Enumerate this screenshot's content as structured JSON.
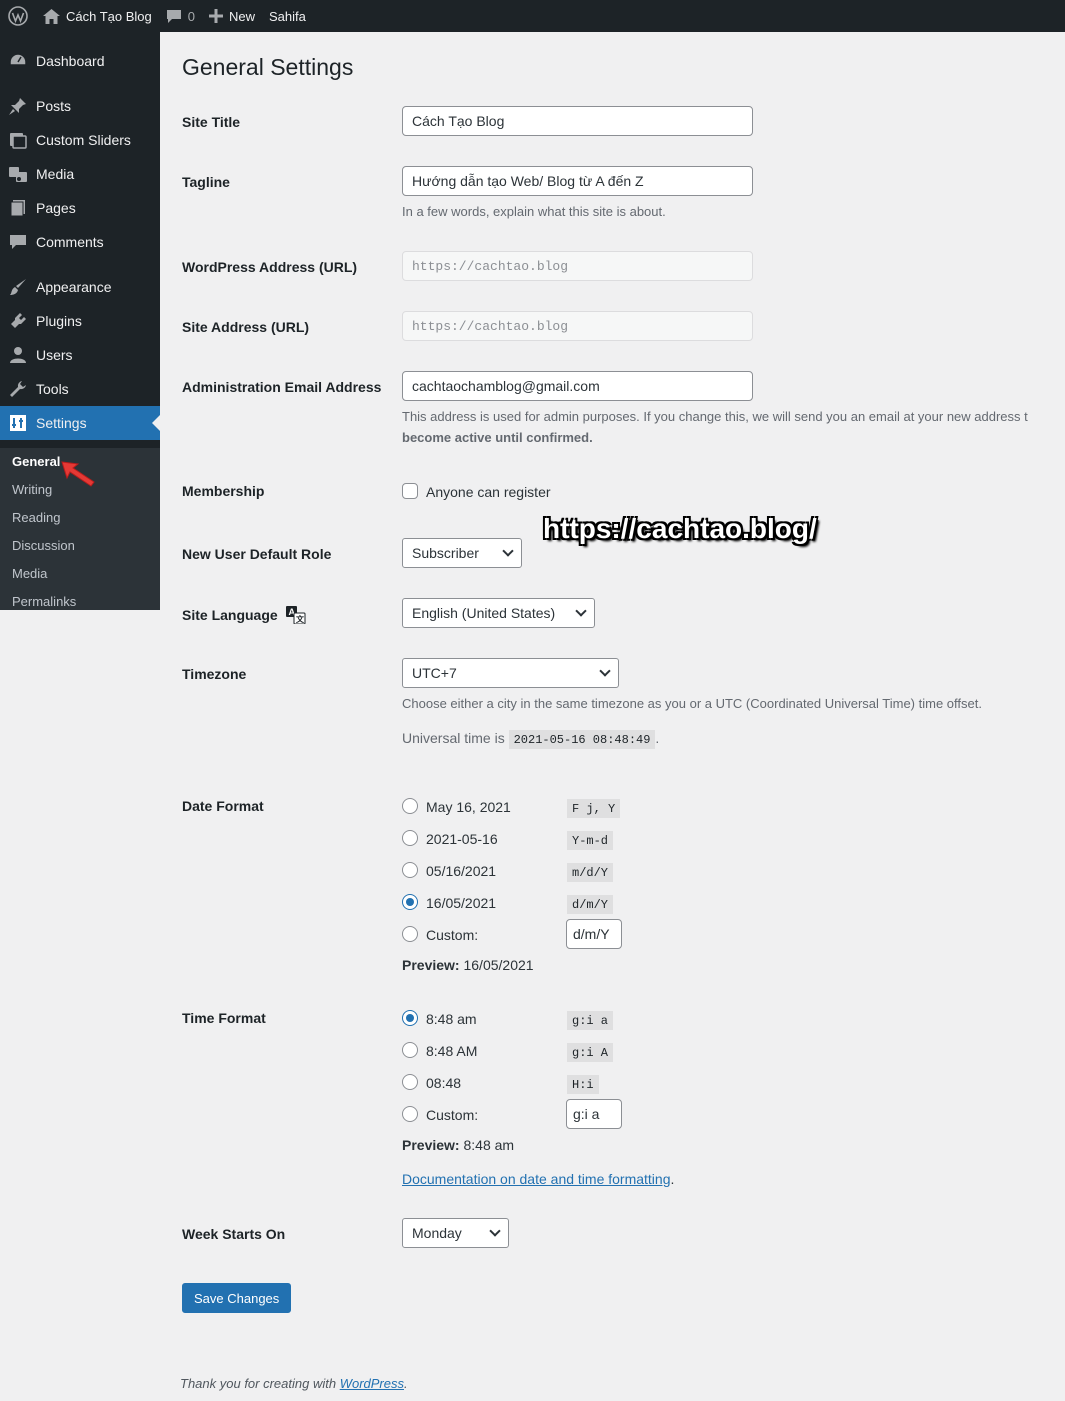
{
  "admin_bar": {
    "site_name": "Cách Tạo Blog",
    "comments_count": "0",
    "new_label": "New",
    "theme_label": "Sahifa"
  },
  "sidebar": {
    "items": [
      {
        "label": "Dashboard",
        "icon": "dashboard-icon"
      },
      {
        "label": "Posts",
        "icon": "pin-icon"
      },
      {
        "label": "Custom Sliders",
        "icon": "sliders-icon"
      },
      {
        "label": "Media",
        "icon": "media-icon"
      },
      {
        "label": "Pages",
        "icon": "page-icon"
      },
      {
        "label": "Comments",
        "icon": "comment-icon"
      },
      {
        "label": "Appearance",
        "icon": "brush-icon"
      },
      {
        "label": "Plugins",
        "icon": "plugin-icon"
      },
      {
        "label": "Users",
        "icon": "user-icon"
      },
      {
        "label": "Tools",
        "icon": "wrench-icon"
      },
      {
        "label": "Settings",
        "icon": "settings-icon"
      }
    ],
    "submenu": [
      "General",
      "Writing",
      "Reading",
      "Discussion",
      "Media",
      "Permalinks"
    ]
  },
  "page": {
    "title": "General Settings",
    "site_title": {
      "label": "Site Title",
      "value": "Cách Tạo Blog"
    },
    "tagline": {
      "label": "Tagline",
      "value": "Hướng dẫn tạo Web/ Blog từ A đến Z",
      "desc": "In a few words, explain what this site is about."
    },
    "wp_address": {
      "label": "WordPress Address (URL)",
      "value": "https://cachtao.blog"
    },
    "site_address": {
      "label": "Site Address (URL)",
      "value": "https://cachtao.blog"
    },
    "admin_email": {
      "label": "Administration Email Address",
      "value": "cachtaochamblog@gmail.com",
      "desc_line1": "This address is used for admin purposes. If you change this, we will send you an email at your new address t",
      "desc_line2": "become active until confirmed."
    },
    "membership": {
      "label": "Membership",
      "checkbox_label": "Anyone can register",
      "checked": false
    },
    "default_role": {
      "label": "New User Default Role",
      "value": "Subscriber"
    },
    "language": {
      "label": "Site Language",
      "value": "English (United States)"
    },
    "timezone": {
      "label": "Timezone",
      "value": "UTC+7",
      "desc": "Choose either a city in the same timezone as you or a UTC (Coordinated Universal Time) time offset.",
      "universal_prefix": "Universal time is",
      "universal_time": "2021-05-16 08:48:49",
      "universal_suffix": "."
    },
    "date_format": {
      "label": "Date Format",
      "options": [
        {
          "label": "May 16, 2021",
          "code": "F j, Y",
          "checked": false
        },
        {
          "label": "2021-05-16",
          "code": "Y-m-d",
          "checked": false
        },
        {
          "label": "05/16/2021",
          "code": "m/d/Y",
          "checked": false
        },
        {
          "label": "16/05/2021",
          "code": "d/m/Y",
          "checked": true
        }
      ],
      "custom_label": "Custom:",
      "custom_value": "d/m/Y",
      "preview_label": "Preview:",
      "preview_value": "16/05/2021"
    },
    "time_format": {
      "label": "Time Format",
      "options": [
        {
          "label": "8:48 am",
          "code": "g:i a",
          "checked": true
        },
        {
          "label": "8:48 AM",
          "code": "g:i A",
          "checked": false
        },
        {
          "label": "08:48",
          "code": "H:i",
          "checked": false
        }
      ],
      "custom_label": "Custom:",
      "custom_value": "g:i a",
      "preview_label": "Preview:",
      "preview_value": "8:48 am"
    },
    "doc_link": "Documentation on date and time formatting",
    "doc_link_suffix": ".",
    "week_starts": {
      "label": "Week Starts On",
      "value": "Monday"
    },
    "save_button": "Save Changes",
    "footer_prefix": "Thank you for creating with",
    "footer_link": "WordPress",
    "footer_suffix": "."
  },
  "watermark": "https://cachtao.blog/",
  "colors": {
    "accent": "#2271b1",
    "adminbar": "#1d2327",
    "submenu_bg": "#2c3338",
    "arrow": "#e53935"
  }
}
